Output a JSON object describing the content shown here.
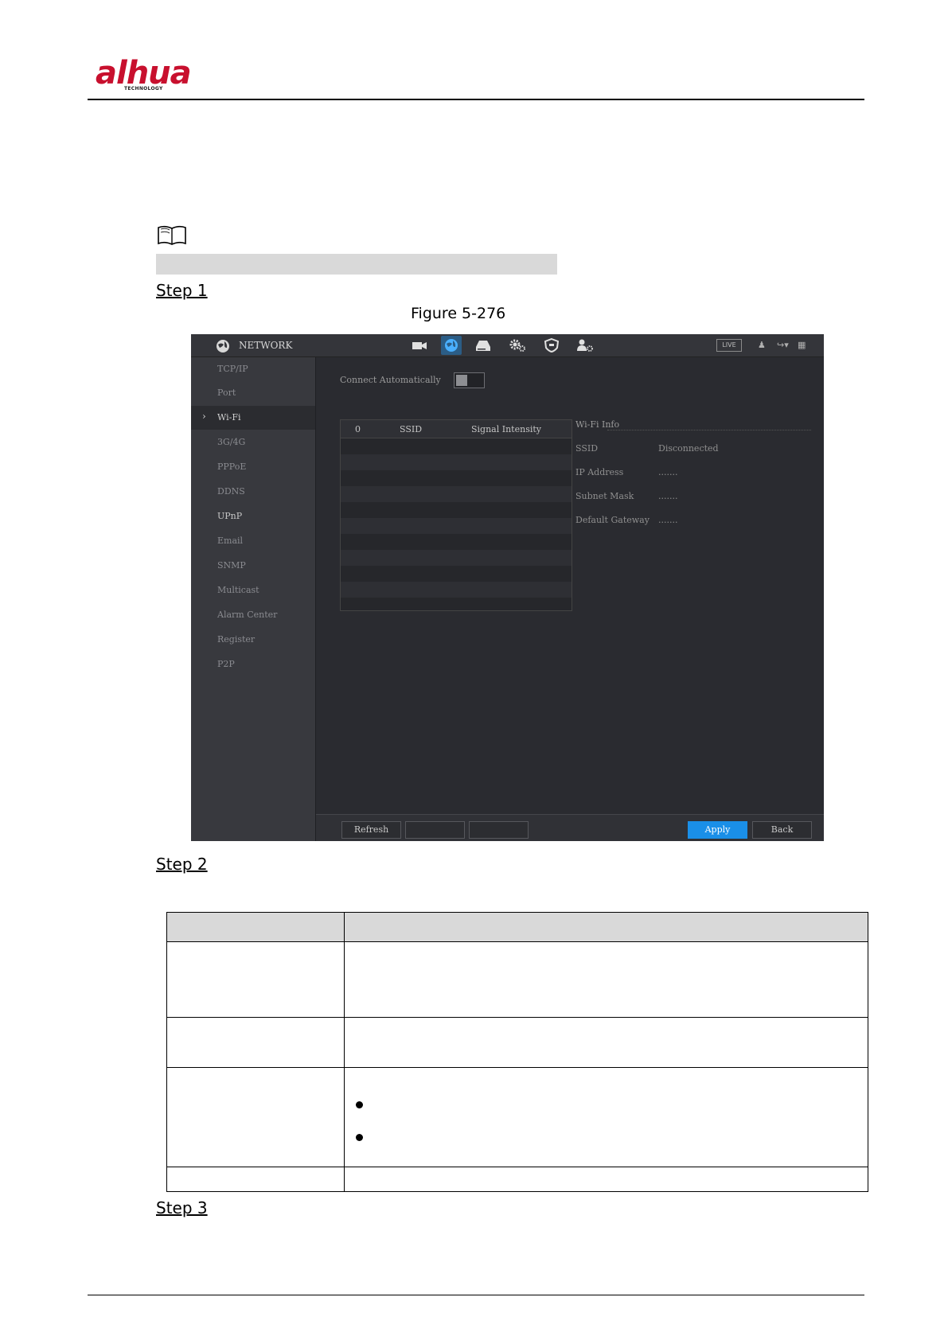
{
  "header": {
    "brand": "alhua",
    "brand_sub": "TECHNOLOGY"
  },
  "steps": {
    "step1": "Step 1",
    "step2": "Step 2",
    "step3": "Step 3"
  },
  "figure": {
    "caption": "Figure 5-276"
  },
  "ui": {
    "title": "NETWORK",
    "live": "LIVE",
    "nav": [
      "TCP/IP",
      "Port",
      "Wi-Fi",
      "3G/4G",
      "PPPoE",
      "DDNS",
      "UPnP",
      "Email",
      "SNMP",
      "Multicast",
      "Alarm Center",
      "Register",
      "P2P"
    ],
    "selected_nav": "Wi-Fi",
    "connect_auto_label": "Connect Automatically",
    "table_headers": {
      "col0": "0",
      "col1": "SSID",
      "col2": "Signal Intensity"
    },
    "wifi_info": {
      "title": "Wi-Fi Info",
      "rows": [
        {
          "key": "SSID",
          "value": "Disconnected"
        },
        {
          "key": "IP Address",
          "value": "......."
        },
        {
          "key": "Subnet Mask",
          "value": "......."
        },
        {
          "key": "Default Gateway",
          "value": "......."
        }
      ]
    },
    "buttons": {
      "refresh": "Refresh",
      "apply": "Apply",
      "back": "Back"
    }
  }
}
